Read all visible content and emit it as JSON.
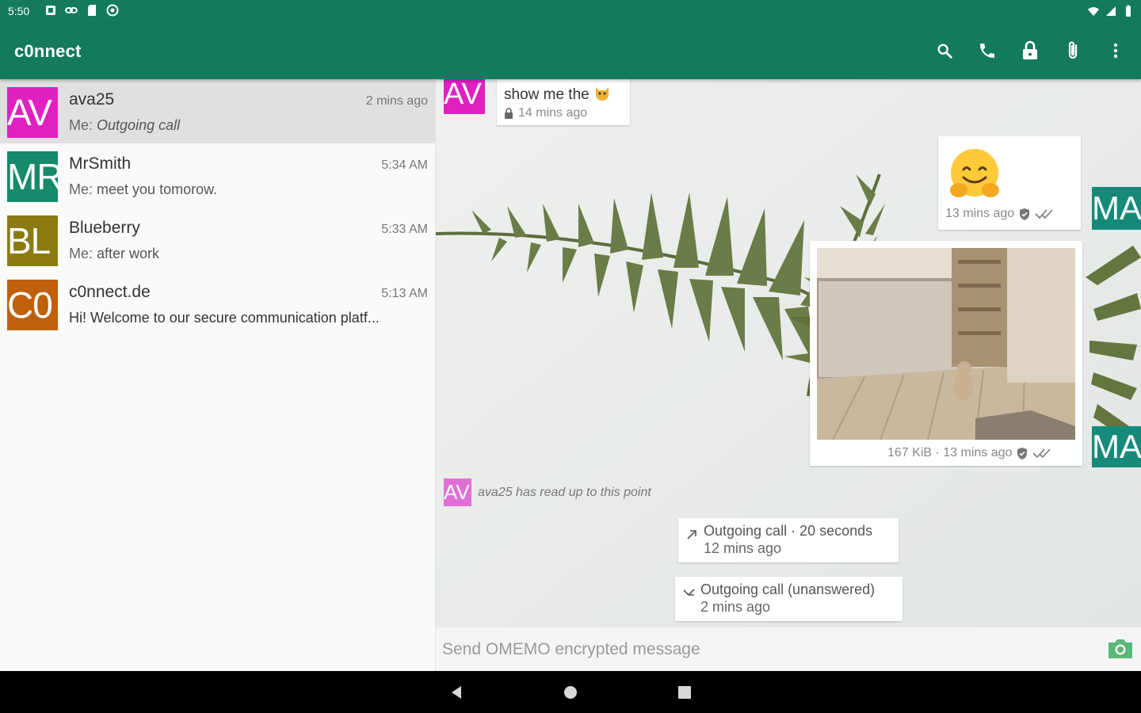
{
  "status_bar": {
    "time": "5:50"
  },
  "toolbar": {
    "title": "c0nnect",
    "actions": [
      "search-icon",
      "phone-icon",
      "lock-icon",
      "attach-icon",
      "more-vert-icon"
    ]
  },
  "colors": {
    "primary": "#137a5e",
    "selected_row": "#e0e0e0",
    "ma_avatar": "#168a7a"
  },
  "conversations": [
    {
      "avatar": "AV",
      "avatar_color": "#e020c0",
      "name": "ava25",
      "time": "2 mins ago",
      "me": "Me:",
      "preview": "Outgoing call",
      "italic": true,
      "selected": true
    },
    {
      "avatar": "MR",
      "avatar_color": "#168a6a",
      "name": "MrSmith",
      "time": "5:34 AM",
      "me": "Me:",
      "preview": "meet you tomorow.",
      "italic": false,
      "selected": false
    },
    {
      "avatar": "BL",
      "avatar_color": "#8a7a10",
      "name": "Blueberry",
      "time": "5:33 AM",
      "me": "Me:",
      "preview": "after work",
      "italic": false,
      "selected": false
    },
    {
      "avatar": "C0",
      "avatar_color": "#c0600a",
      "name": "c0nnect.de",
      "time": "5:13 AM",
      "me": "",
      "preview": "Hi! Welcome to our secure communication platf...",
      "italic": false,
      "selected": false
    }
  ],
  "chat": {
    "msg1": {
      "avatar": "AV",
      "text": "show me the",
      "time": "14 mins ago"
    },
    "msg2": {
      "avatar": "MA",
      "time": "13 mins ago"
    },
    "msg3": {
      "avatar": "MA",
      "meta": "167 KiB · 13 mins ago"
    },
    "read_marker": {
      "avatar": "AV",
      "text": "ava25 has read up to this point"
    },
    "calls": [
      {
        "line1": "Outgoing call · 20 seconds",
        "line2": "12 mins ago"
      },
      {
        "line1": "Outgoing call (unanswered)",
        "line2": "2 mins ago"
      }
    ]
  },
  "input": {
    "placeholder": "Send OMEMO encrypted message"
  }
}
